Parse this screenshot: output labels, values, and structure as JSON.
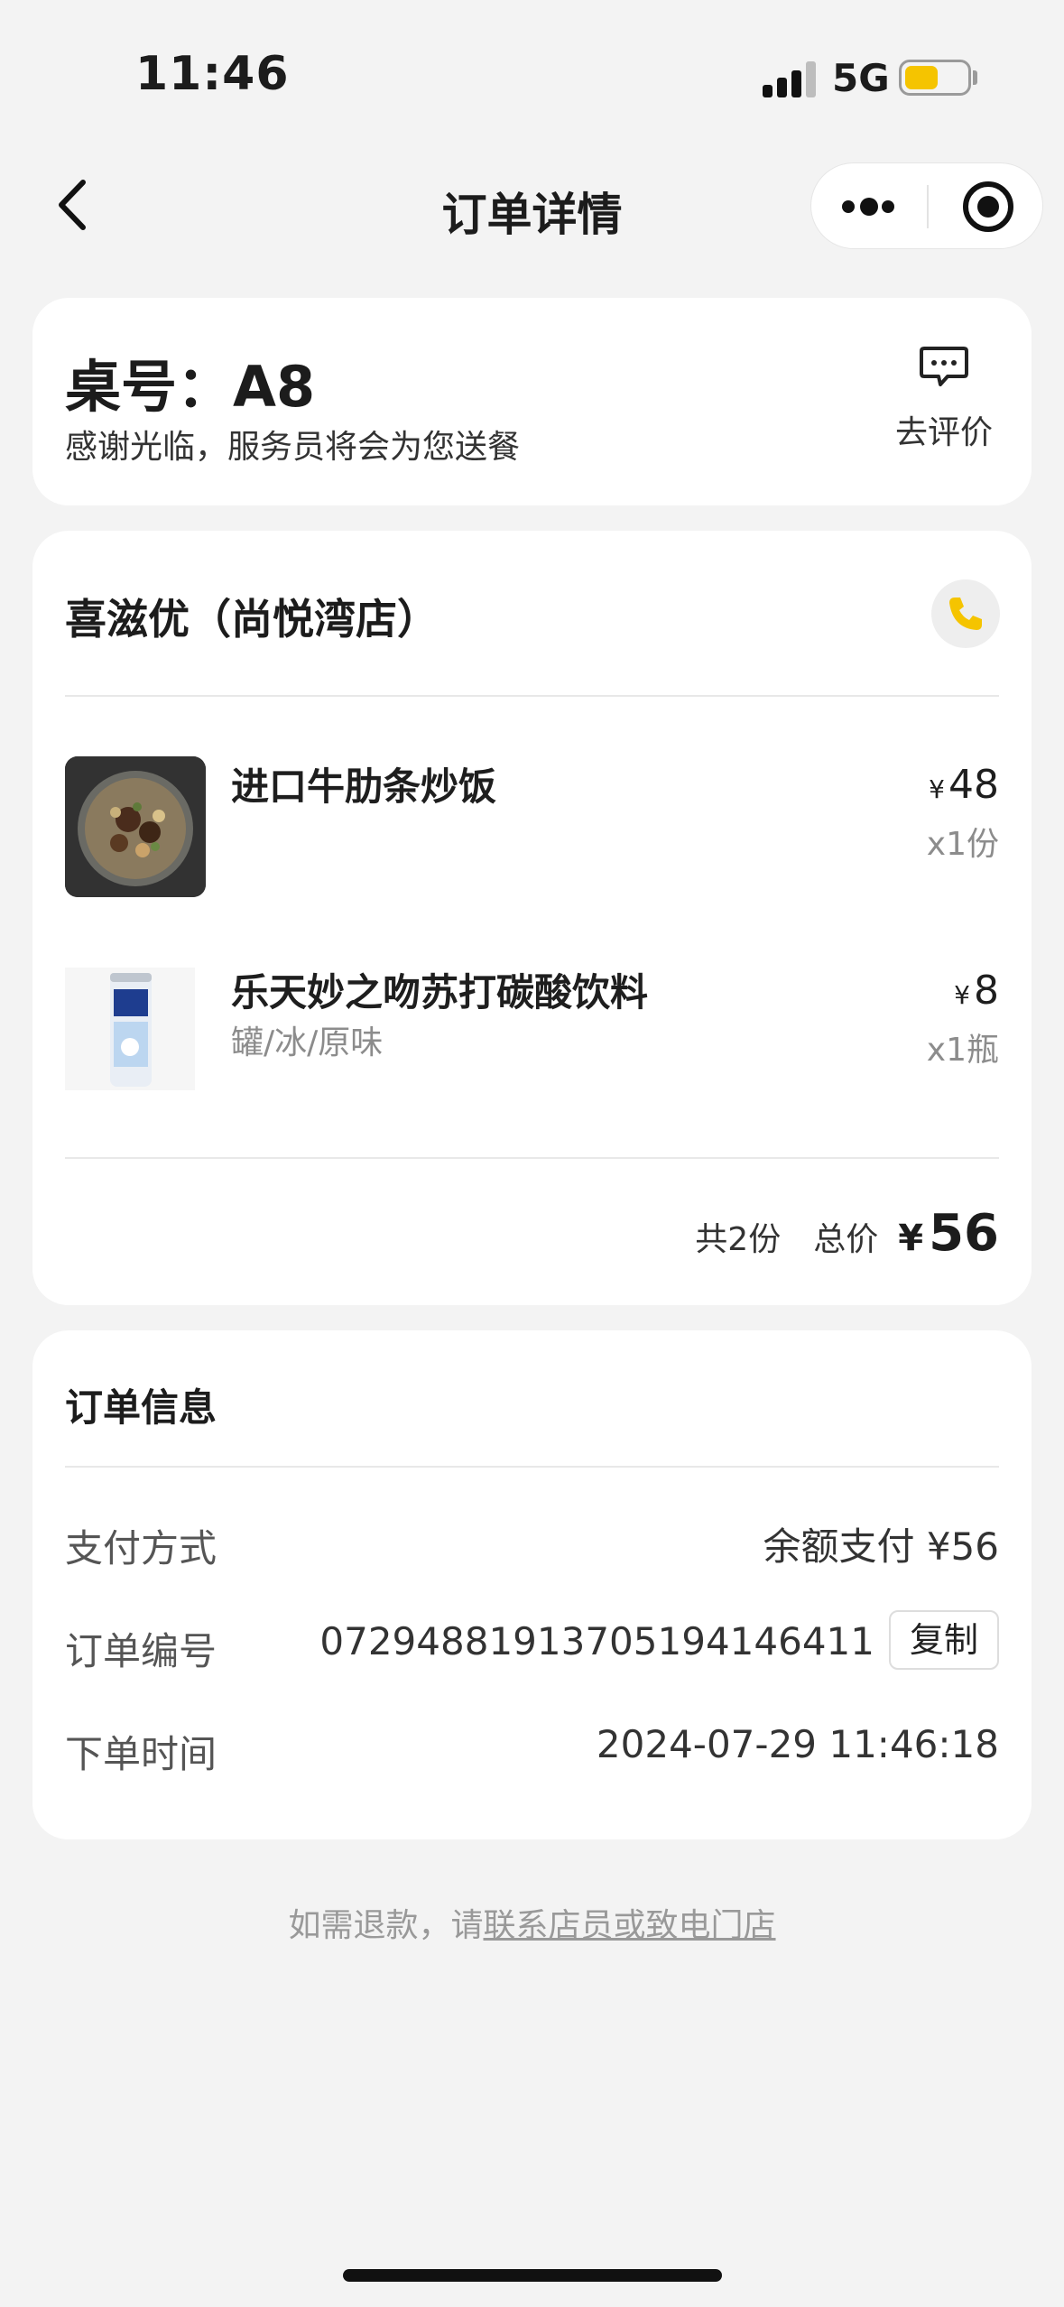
{
  "status_bar": {
    "time": "11:46",
    "network": "5G",
    "battery_level": 0.55,
    "battery_color": "#f5c400"
  },
  "nav": {
    "title": "订单详情",
    "back_icon": "chevron-left-icon",
    "more_icon": "more-dots-icon",
    "close_icon": "target-icon"
  },
  "table_card": {
    "table_label": "桌号：A8",
    "message": "感谢光临，服务员将会为您送餐",
    "review_label": "去评价",
    "review_icon": "chat-bubble-icon"
  },
  "order_card": {
    "store_name": "喜滋优（尚悦湾店）",
    "phone_icon": "phone-icon",
    "accent_color": "#f5c400",
    "items": [
      {
        "name": "进口牛肋条炒饭",
        "spec": "",
        "currency": "¥",
        "price": "48",
        "qty": "x1份",
        "image": "fried-rice-thumbnail"
      },
      {
        "name": "乐天妙之吻苏打碳酸饮料",
        "spec": "罐/冰/原味",
        "currency": "¥",
        "price": "8",
        "qty": "x1瓶",
        "image": "soda-can-thumbnail"
      }
    ],
    "total_count": "共2份",
    "total_label": "总价",
    "total_currency": "¥",
    "total_amount": "56"
  },
  "info_card": {
    "title": "订单信息",
    "payment_label": "支付方式",
    "payment_value": "余额支付 ¥56",
    "order_no_label": "订单编号",
    "order_no_value": "0729488191370519414641​1",
    "copy_label": "复制",
    "order_time_label": "下单时间",
    "order_time_value": "2024-07-29 11:46:18"
  },
  "footer": {
    "prefix": "如需退款，请",
    "link": "联系店员或致电门店"
  }
}
